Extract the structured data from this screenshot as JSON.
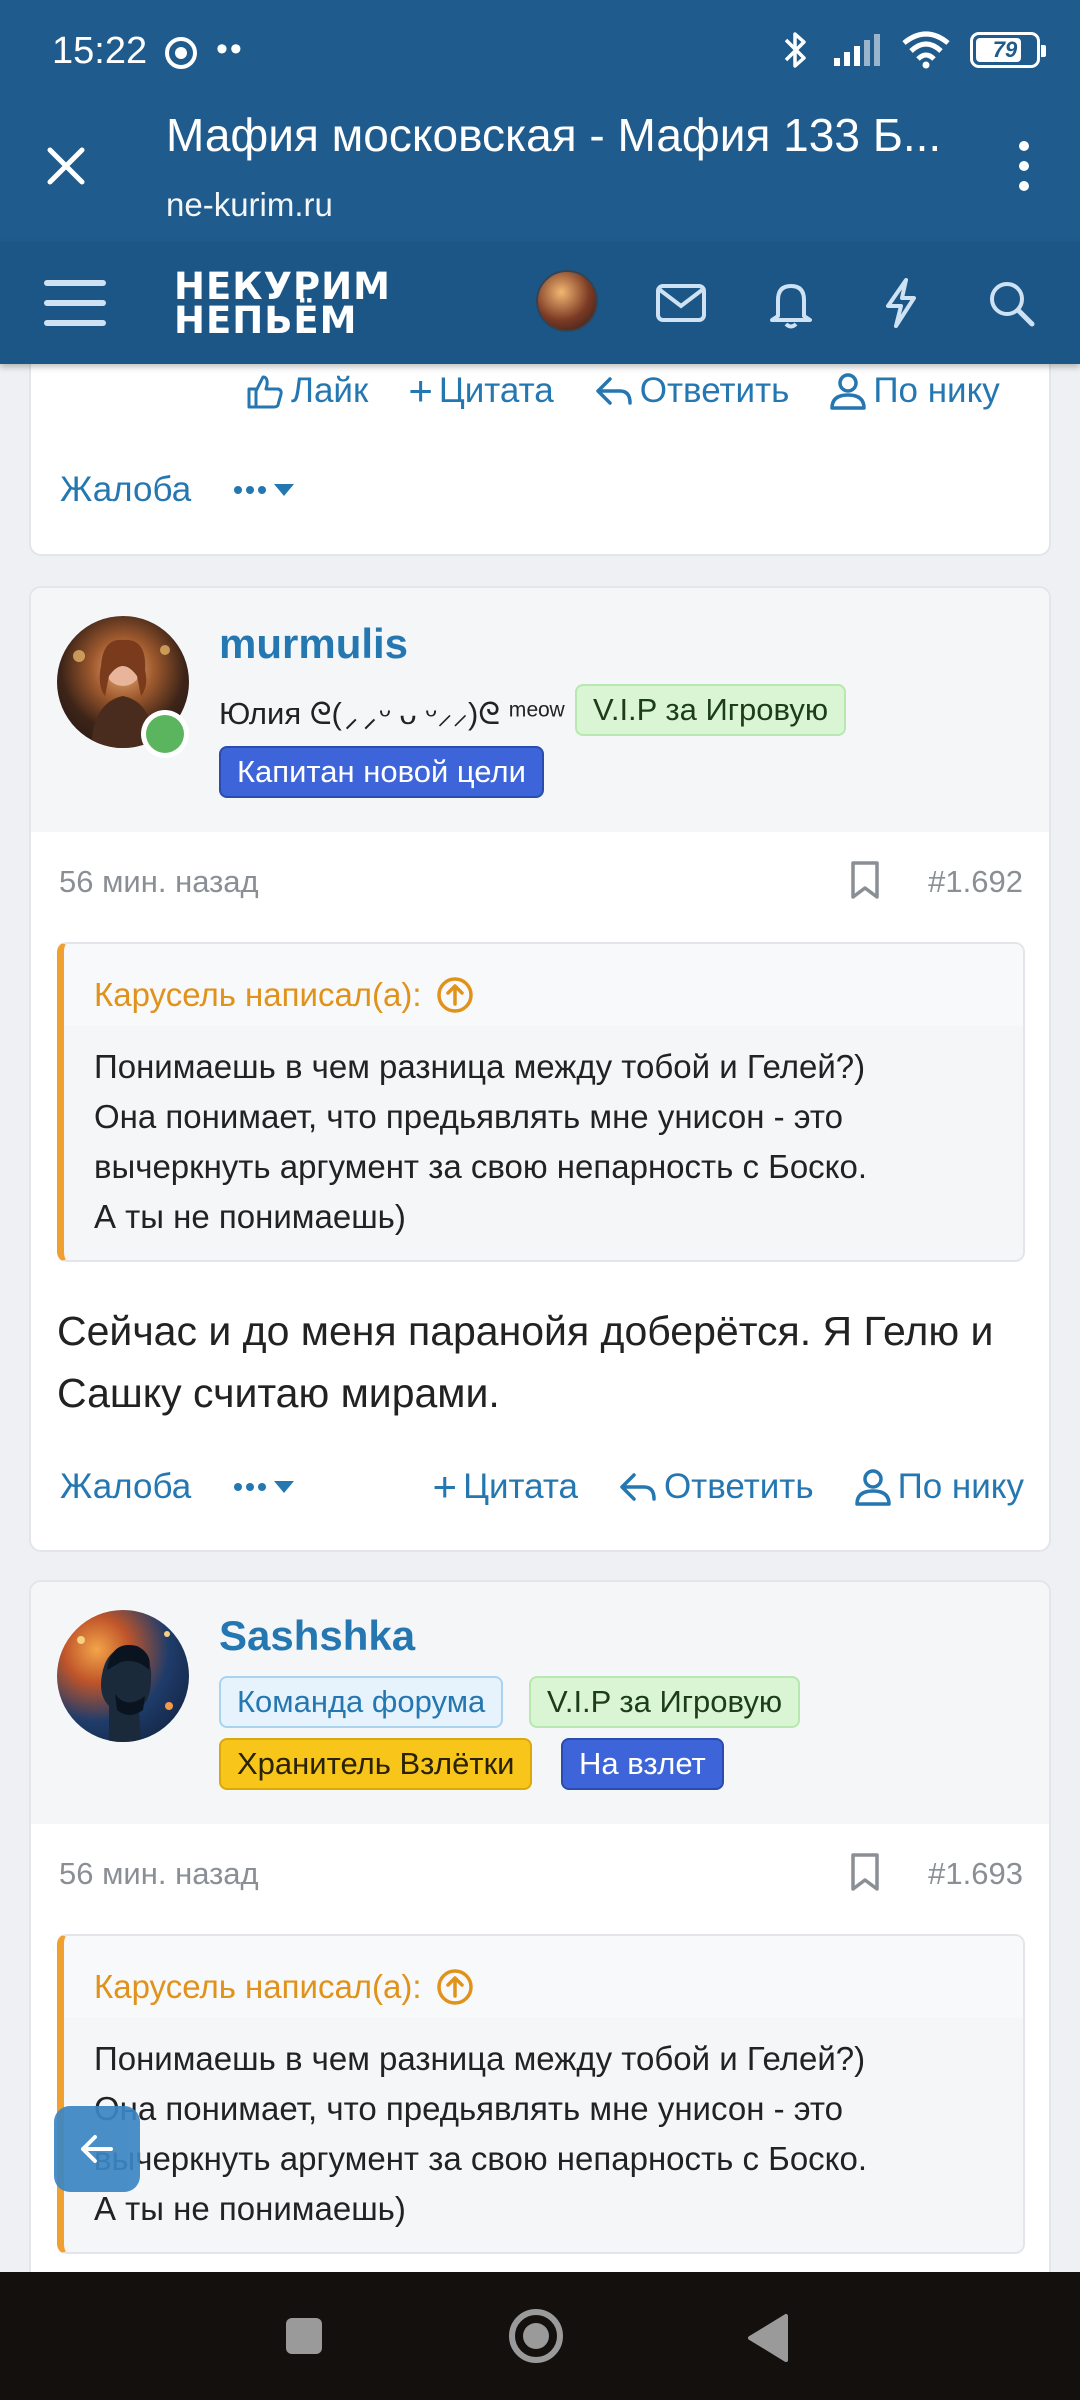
{
  "status_bar": {
    "time": "15:22",
    "dots": "••",
    "battery": "79",
    "battery_level": 0.79
  },
  "browser": {
    "title": "Мафия московская - Мафия 133 Б...",
    "url": "ne-kurim.ru"
  },
  "forum_header": {
    "logo_line1": "НЕКУРИМ",
    "logo_line2": "НЕПЬЁМ"
  },
  "top_card": {
    "like": "Лайк",
    "quote": "Цитата",
    "reply": "Ответить",
    "by_nick": "По нику",
    "report": "Жалоба"
  },
  "post1": {
    "username": "murmulis",
    "user_title": "Юлия ᘓ(⸝⸝ᵕ ᴗ ᵕ⸝⸝)ᘓ ᵐᵉᵒʷ ⸝⸝-",
    "badges": [
      "V.I.P за Игровую",
      "Капитан новой цели"
    ],
    "time": "56 мин. назад",
    "number": "#1.692",
    "quote_author": "Карусель написал(а):",
    "quote_lines": [
      "Понимаешь в чем разница между тобой и Гелей?)",
      "Она понимает, что предьявлять мне унисон - это",
      "вычеркнуть аргумент за свою непарность с Боско.",
      "А ты не понимаешь)"
    ],
    "message": "Сейчас и до меня паранойя доберётся. Я Гелю и Сашку считаю мирами.",
    "report": "Жалоба",
    "quote": "Цитата",
    "reply": "Ответить",
    "by_nick": "По нику"
  },
  "post2": {
    "username": "Sashshka",
    "badges": [
      "Команда форума",
      "V.I.P за Игровую",
      "Хранитель Взлётки",
      "На взлет"
    ],
    "time": "56 мин. назад",
    "number": "#1.693",
    "quote_author": "Карусель написал(а):",
    "quote_lines": [
      "Понимаешь в чем разница между тобой и Гелей?)",
      "Она понимает, что предьявлять мне унисон - это",
      "вычеркнуть аргумент за свою непарность с Боско.",
      "А ты не понимаешь)"
    ]
  },
  "colors": {
    "header": "#1f5b8c",
    "link": "#2577b1",
    "quote_accent": "#f0a030"
  }
}
